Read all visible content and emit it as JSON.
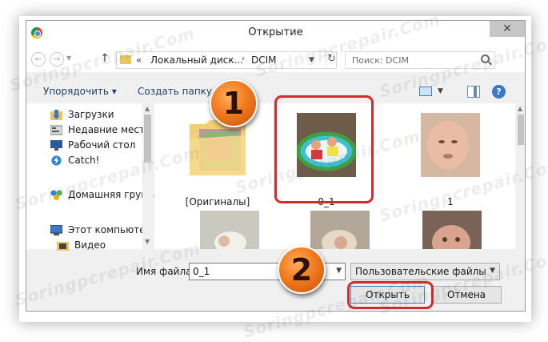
{
  "window": {
    "title": "Открытие",
    "close_glyph": "✕"
  },
  "nav": {
    "address": {
      "prefix": "«",
      "disk": "Локальный диск...",
      "separator": "›",
      "folder": "DCIM"
    },
    "search": {
      "placeholder": "Поиск: DCIM"
    }
  },
  "toolbar": {
    "organize_label": "Упорядочить ▾",
    "new_folder_label": "Создать папку"
  },
  "sidebar": {
    "items": [
      {
        "label": "Загрузки",
        "icon": "downloads-icon"
      },
      {
        "label": "Недавние места",
        "icon": "recent-places-icon"
      },
      {
        "label": "Рабочий стол",
        "icon": "desktop-icon"
      },
      {
        "label": "Catch!",
        "icon": "catch-icon"
      },
      {
        "label": "Домашняя группа",
        "icon": "homegroup-icon"
      },
      {
        "label": "Этот компьютер",
        "icon": "computer-icon"
      },
      {
        "label": "Видео",
        "icon": "video-folder-icon"
      }
    ]
  },
  "files": [
    {
      "label": "[Оригиналы]",
      "kind": "folder"
    },
    {
      "label": "0_1",
      "kind": "image",
      "selected": true
    },
    {
      "label": "1",
      "kind": "image"
    },
    {
      "label": "",
      "kind": "image"
    },
    {
      "label": "",
      "kind": "image"
    },
    {
      "label": "",
      "kind": "image"
    }
  ],
  "bottom": {
    "filename_label": "Имя файла:",
    "filename_value": "0_1",
    "filetype_value": "Пользовательские файлы",
    "open_label": "Открыть",
    "cancel_label": "Отмена"
  },
  "markers": [
    {
      "number": "1"
    },
    {
      "number": "2"
    }
  ],
  "watermark": "Soringpcrepair.Com",
  "colors": {
    "highlight": "#d42a2a",
    "marker": "#f27b1e",
    "accent": "#3c7fb1"
  }
}
